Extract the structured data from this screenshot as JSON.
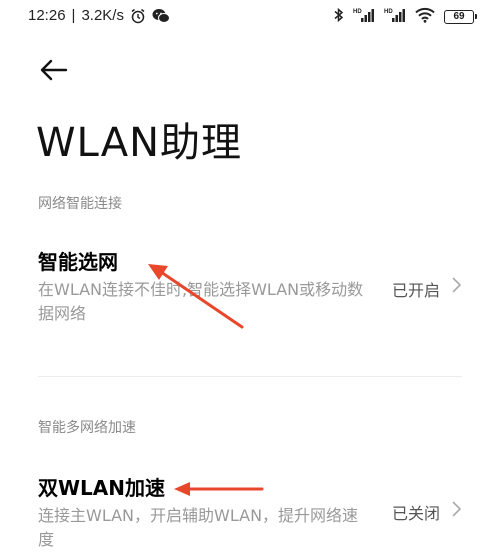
{
  "status_bar": {
    "time": "12:26",
    "net_speed": "3.2K/s",
    "battery_level": "69",
    "separator": "|",
    "signal_label": "HD"
  },
  "page": {
    "title": "WLAN助理"
  },
  "sections": [
    {
      "header": "网络智能连接",
      "item": {
        "title": "智能选网",
        "description": "在WLAN连接不佳时,智能选择WLAN或移动数据网络",
        "value": "已开启"
      }
    },
    {
      "header": "智能多网络加速",
      "item": {
        "title": "双WLAN加速",
        "description": "连接主WLAN，开启辅助WLAN，提升网络速度",
        "value": "已关闭"
      }
    }
  ],
  "colors": {
    "annotation_arrow": "#e8472c",
    "section_header": "#8a8a8a",
    "description": "#999999"
  },
  "icons": [
    "back-arrow-icon",
    "alarm-icon",
    "wechat-icon",
    "bluetooth-icon",
    "signal-icon",
    "wifi-icon",
    "battery-icon",
    "chevron-right-icon"
  ]
}
